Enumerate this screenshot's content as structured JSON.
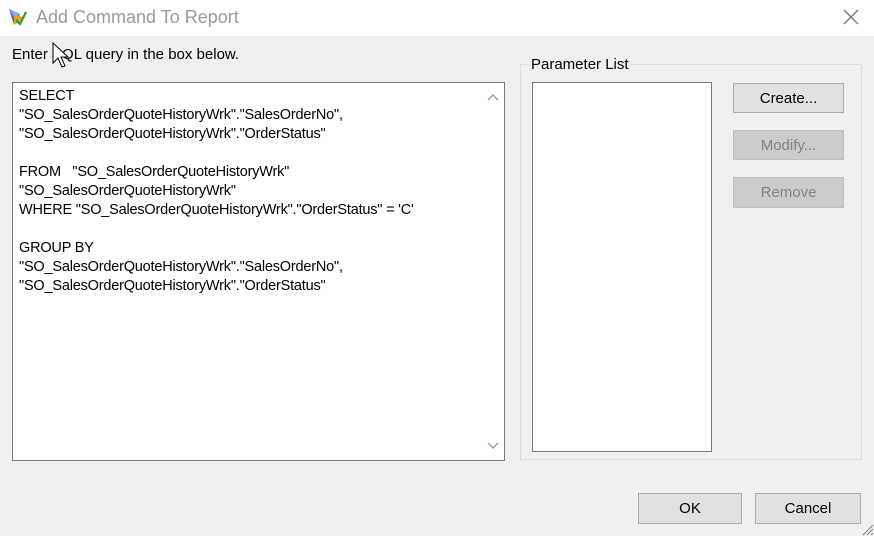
{
  "window": {
    "title": "Add Command To Report",
    "icon": "crystal-reports-app-icon",
    "close_icon": "close-icon"
  },
  "instruction": "Enter SQL query in the box below.",
  "sql_query": "SELECT\n\"SO_SalesOrderQuoteHistoryWrk\".\"SalesOrderNo\",\n\"SO_SalesOrderQuoteHistoryWrk\".\"OrderStatus\"\n\nFROM   \"SO_SalesOrderQuoteHistoryWrk\"\n\"SO_SalesOrderQuoteHistoryWrk\"\nWHERE \"SO_SalesOrderQuoteHistoryWrk\".\"OrderStatus\" = 'C'\n\nGROUP BY\n\"SO_SalesOrderQuoteHistoryWrk\".\"SalesOrderNo\",\n\"SO_SalesOrderQuoteHistoryWrk\".\"OrderStatus\"",
  "parameters": {
    "label": "Parameter List",
    "items": [],
    "create_label": "Create...",
    "modify_label": "Modify...",
    "remove_label": "Remove"
  },
  "footer": {
    "ok_label": "OK",
    "cancel_label": "Cancel"
  },
  "colors": {
    "title_text": "#9a9a9a",
    "dialog_bg": "#f0f0f0",
    "disabled_text": "#838383"
  }
}
